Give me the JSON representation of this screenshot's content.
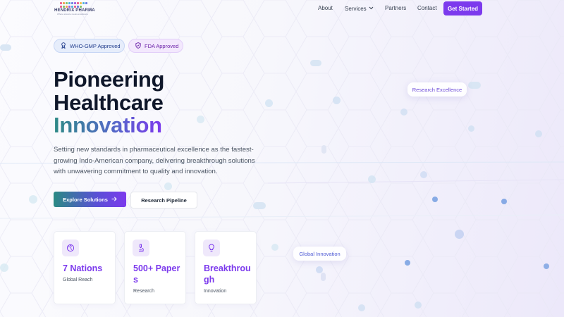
{
  "colors": {
    "accent": "#7c3aed",
    "teal": "#2e8a86",
    "heading": "#0f172a",
    "body_text": "#4b5563"
  },
  "brand": {
    "name": "HENDRIX PHARMA",
    "tagline": "Where science meets excellence"
  },
  "nav": {
    "items": [
      {
        "label": "About"
      },
      {
        "label": "Services",
        "icon": "chevron-down-icon"
      },
      {
        "label": "Partners"
      },
      {
        "label": "Contact"
      }
    ],
    "cta_label": "Get Started"
  },
  "badges": [
    {
      "label": "WHO-GMP Approved",
      "icon": "award-icon"
    },
    {
      "label": "FDA Approved",
      "icon": "shield-check-icon"
    }
  ],
  "hero": {
    "headline_lines": [
      "Pioneering",
      "Healthcare",
      "Innovation"
    ],
    "description": "Setting new standards in pharmaceutical excellence as the fastest-growing Indo-American company, delivering breakthrough solutions with unwavering commitment to quality and innovation.",
    "primary_button": "Explore Solutions",
    "secondary_button": "Research Pipeline"
  },
  "stats": [
    {
      "value": "7 Nations",
      "label": "Global Reach",
      "icon": "globe-icon"
    },
    {
      "value": "500+ Papers",
      "label": "Research",
      "icon": "microscope-icon"
    },
    {
      "value": "Breakthrough",
      "label": "Innovation",
      "icon": "lightbulb-icon"
    }
  ],
  "floating_tags": {
    "research": "Research Excellence",
    "global": "Global Innovation"
  }
}
